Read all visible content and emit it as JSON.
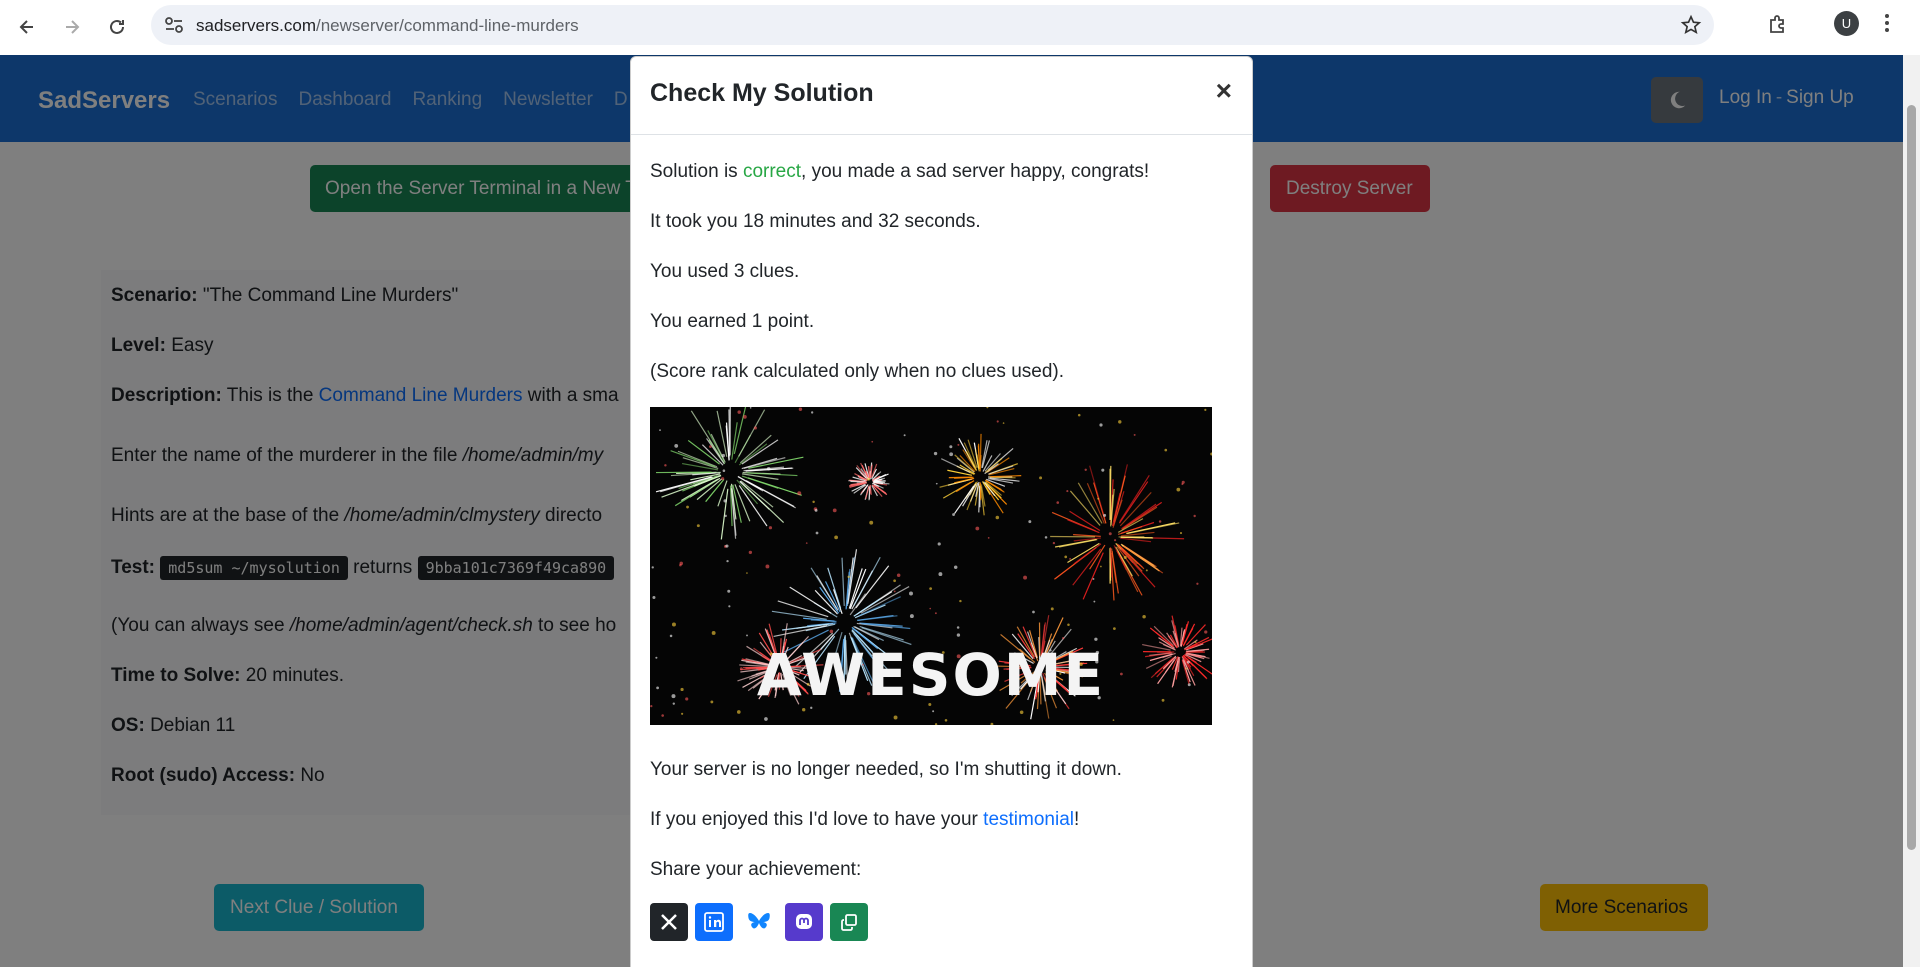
{
  "browser": {
    "url_host": "sadservers.com",
    "url_path": "/newserver/command-line-murders",
    "profile_initial": "U"
  },
  "navbar": {
    "brand": "SadServers",
    "links": [
      "Scenarios",
      "Dashboard",
      "Ranking",
      "Newsletter",
      "D"
    ],
    "login": "Log In",
    "separator": "-",
    "signup": "Sign Up"
  },
  "actions": {
    "open_terminal": "Open the Server Terminal in a New Tab",
    "destroy": "Destroy Server",
    "next_clue": "Next Clue / Solution",
    "more_scenarios": "More Scenarios"
  },
  "scenario": {
    "scenario_label": "Scenario:",
    "scenario_value": "\"The Command Line Murders\"",
    "level_label": "Level:",
    "level_value": "Easy",
    "description_label": "Description:",
    "description_pre": "This is the ",
    "description_link": "Command Line Murders",
    "description_post": " with a sma",
    "enter_pre": "Enter the name of the murderer in the file ",
    "enter_path": "/home/admin/my",
    "hints_pre": "Hints are at the base of the ",
    "hints_path": "/home/admin/clmystery",
    "hints_post": " directo",
    "test_label": "Test:",
    "test_cmd": "md5sum ~/mysolution",
    "test_returns": "returns",
    "test_hash": "9bba101c7369f49ca890",
    "check_pre": "(You can always see ",
    "check_path": "/home/admin/agent/check.sh",
    "check_post": " to see ho",
    "time_label": "Time to Solve:",
    "time_value": "20 minutes.",
    "os_label": "OS:",
    "os_value": "Debian 11",
    "root_label": "Root (sudo) Access:",
    "root_value": "No"
  },
  "modal": {
    "title": "Check My Solution",
    "close": "×",
    "sol_pre": "Solution is ",
    "sol_status": "correct",
    "sol_post": ", you made a sad server happy, congrats!",
    "time_took": "It took you 18 minutes and 32 seconds.",
    "clues": "You used 3 clues.",
    "points": "You earned 1 point.",
    "rank_note": "(Score rank calculated only when no clues used).",
    "image_text": "AWESOME",
    "shutdown": "Your server is no longer needed, so I'm shutting it down.",
    "testimonial_pre": "If you enjoyed this I'd love to have your ",
    "testimonial_link": "testimonial",
    "testimonial_post": "!",
    "share": "Share your achievement:",
    "share_buttons": [
      {
        "name": "x-icon",
        "color": "#212529"
      },
      {
        "name": "linkedin-icon",
        "color": "#0d6efd"
      },
      {
        "name": "bluesky-icon",
        "color": "#ffffff"
      },
      {
        "name": "mastodon-icon",
        "color": "#563acc"
      },
      {
        "name": "copy-icon",
        "color": "#198754"
      }
    ]
  }
}
